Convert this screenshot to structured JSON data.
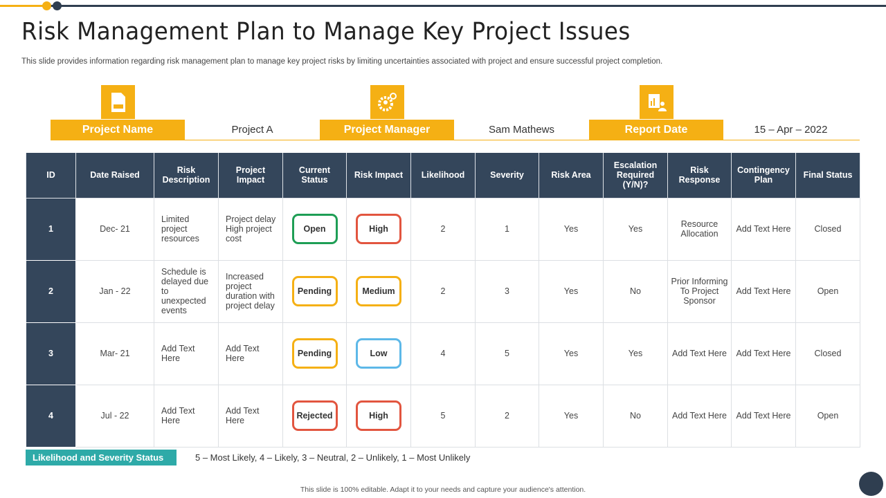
{
  "title": "Risk Management Plan to Manage Key Project Issues",
  "subtitle": "This slide provides information regarding risk management plan to manage key project risks by limiting uncertainties associated with project and ensure successful project completion.",
  "info": [
    {
      "label": "Project Name",
      "value": "Project A",
      "icon": "xls-file-icon"
    },
    {
      "label": "Project Manager",
      "value": "Sam Mathews",
      "icon": "gear-person-icon"
    },
    {
      "label": "Report Date",
      "value": "15 – Apr – 2022",
      "icon": "report-person-icon"
    }
  ],
  "colors": {
    "accent": "#f5b014",
    "header": "#34465b",
    "green": "#1e9e55",
    "red": "#e2553f",
    "yellow": "#f5b014",
    "blue": "#5db8e8",
    "teal": "#2eaaa8"
  },
  "table": {
    "headers": [
      "ID",
      "Date Raised",
      "Risk Description",
      "Project Impact",
      "Current Status",
      "Risk Impact",
      "Likelihood",
      "Severity",
      "Risk Area",
      "Escalation Required (Y/N)?",
      "Risk Response",
      "Contingency Plan",
      "Final Status"
    ],
    "rows": [
      {
        "id": "1",
        "date": "Dec- 21",
        "desc": "Limited project resources",
        "impact": "Project delay High project cost",
        "status": "Open",
        "status_color": "#1e9e55",
        "risk": "High",
        "risk_color": "#e2553f",
        "likelihood": "2",
        "severity": "1",
        "area": "Yes",
        "escalation": "Yes",
        "response": "Resource Allocation",
        "contingency": "Add Text Here",
        "final": "Closed"
      },
      {
        "id": "2",
        "date": "Jan - 22",
        "desc": "Schedule is delayed due to unexpected events",
        "impact": "Increased project duration with project delay",
        "status": "Pending",
        "status_color": "#f5b014",
        "risk": "Medium",
        "risk_color": "#f5b014",
        "likelihood": "2",
        "severity": "3",
        "area": "Yes",
        "escalation": "No",
        "response": "Prior Informing To Project Sponsor",
        "contingency": "Add Text Here",
        "final": "Open"
      },
      {
        "id": "3",
        "date": "Mar- 21",
        "desc": "Add Text Here",
        "impact": "Add Text Here",
        "status": "Pending",
        "status_color": "#f5b014",
        "risk": "Low",
        "risk_color": "#5db8e8",
        "likelihood": "4",
        "severity": "5",
        "area": "Yes",
        "escalation": "Yes",
        "response": "Add Text Here",
        "contingency": "Add Text Here",
        "final": "Closed"
      },
      {
        "id": "4",
        "date": "Jul - 22",
        "desc": "Add Text Here",
        "impact": "Add Text Here",
        "status": "Rejected",
        "status_color": "#e2553f",
        "risk": "High",
        "risk_color": "#e2553f",
        "likelihood": "5",
        "severity": "2",
        "area": "Yes",
        "escalation": "No",
        "response": "Add Text Here",
        "contingency": "Add Text Here",
        "final": "Open"
      }
    ]
  },
  "legend": {
    "label": "Likelihood and Severity Status",
    "text": "5 – Most Likely, 4 – Likely, 3 – Neutral, 2 – Unlikely, 1 – Most Unlikely"
  },
  "footer": "This slide is 100% editable. Adapt it to your needs and capture your audience's attention."
}
